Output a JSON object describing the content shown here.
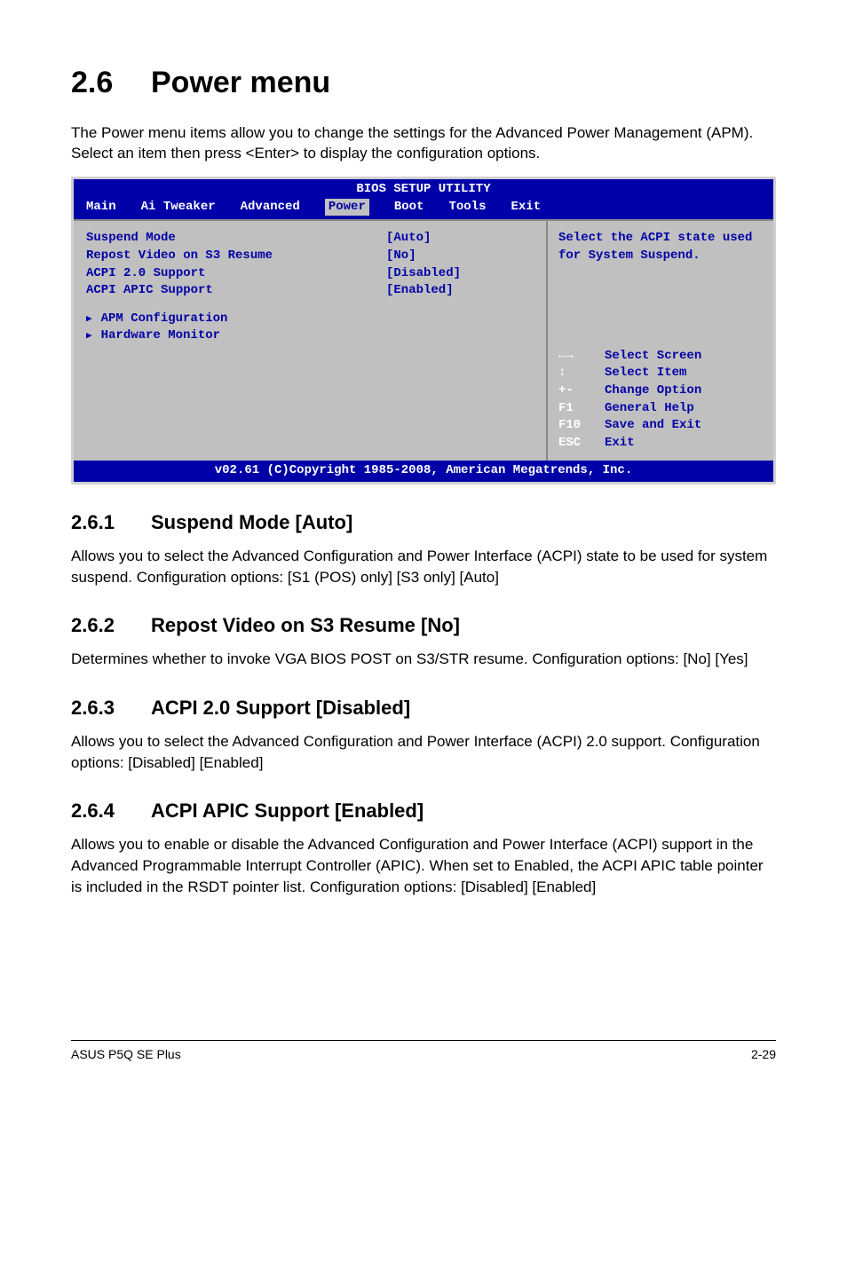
{
  "page": {
    "section_number": "2.6",
    "section_title": "Power menu",
    "intro": "The Power menu items allow you to change the settings for the Advanced Power Management (APM). Select an item then press <Enter> to display the configuration options."
  },
  "bios": {
    "title": "BIOS SETUP UTILITY",
    "tabs": [
      "Main",
      "Ai Tweaker",
      "Advanced",
      "Power",
      "Boot",
      "Tools",
      "Exit"
    ],
    "active_tab": "Power",
    "items": [
      {
        "label": "Suspend Mode",
        "value": "[Auto]"
      },
      {
        "label": "Repost Video on S3 Resume",
        "value": "[No]"
      },
      {
        "label": "ACPI 2.0 Support",
        "value": "[Disabled]"
      },
      {
        "label": "ACPI APIC Support",
        "value": "[Enabled]"
      }
    ],
    "submenus": [
      "APM Configuration",
      "Hardware Monitor"
    ],
    "help_text": "Select the ACPI state used for System Suspend.",
    "nav": [
      {
        "key": "←→",
        "label": "Select Screen"
      },
      {
        "key": "↕",
        "label": "Select Item"
      },
      {
        "key": "+-",
        "label": "Change Option"
      },
      {
        "key": "F1",
        "label": "General Help"
      },
      {
        "key": "F10",
        "label": "Save and Exit"
      },
      {
        "key": "ESC",
        "label": "Exit"
      }
    ],
    "footer": "v02.61 (C)Copyright 1985-2008, American Megatrends, Inc."
  },
  "subsections": [
    {
      "num": "2.6.1",
      "title": "Suspend Mode [Auto]",
      "body": "Allows you to select the Advanced Configuration and Power Interface (ACPI) state to be used for system suspend. Configuration options: [S1 (POS) only] [S3 only] [Auto]"
    },
    {
      "num": "2.6.2",
      "title": "Repost Video on S3 Resume [No]",
      "body": "Determines whether to invoke VGA BIOS POST on S3/STR resume. Configuration options: [No] [Yes]"
    },
    {
      "num": "2.6.3",
      "title": "ACPI 2.0 Support [Disabled]",
      "body": "Allows you to select the Advanced Configuration and Power Interface (ACPI) 2.0 support. Configuration options: [Disabled] [Enabled]"
    },
    {
      "num": "2.6.4",
      "title": "ACPI APIC Support [Enabled]",
      "body": "Allows you to enable or disable the Advanced Configuration and Power Interface (ACPI) support in the Advanced Programmable Interrupt Controller (APIC). When set to Enabled, the ACPI APIC table pointer is included in the RSDT pointer list. Configuration options: [Disabled] [Enabled]"
    }
  ],
  "footer": {
    "left": "ASUS P5Q SE Plus",
    "right": "2-29"
  }
}
